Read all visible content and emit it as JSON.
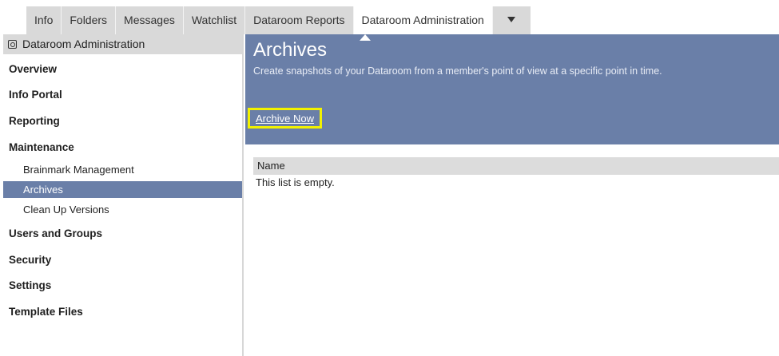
{
  "tabs": [
    "Info",
    "Folders",
    "Messages",
    "Watchlist",
    "Dataroom Reports",
    "Dataroom Administration"
  ],
  "tab_more_icon": "caret-down-icon",
  "sidebar": {
    "header": "Dataroom Administration",
    "header_icon": "admin-icon",
    "items": {
      "overview": "Overview",
      "info_portal": "Info Portal",
      "reporting": "Reporting",
      "maintenance": "Maintenance",
      "brainmark": "Brainmark Management",
      "archives": "Archives",
      "clean_up": "Clean Up Versions",
      "users_groups": "Users and Groups",
      "security": "Security",
      "settings": "Settings",
      "template_files": "Template Files"
    },
    "active_item": "Archives"
  },
  "main": {
    "title": "Archives",
    "description": "Create snapshots of your Dataroom from a member's point of view at a specific point in time.",
    "archive_now": "Archive Now",
    "list_header": "Name",
    "empty_text": "This list is empty."
  },
  "colors": {
    "accent": "#6a7fa8",
    "highlight_border": "#f2f200",
    "tab_bg": "#d9d9d9"
  }
}
